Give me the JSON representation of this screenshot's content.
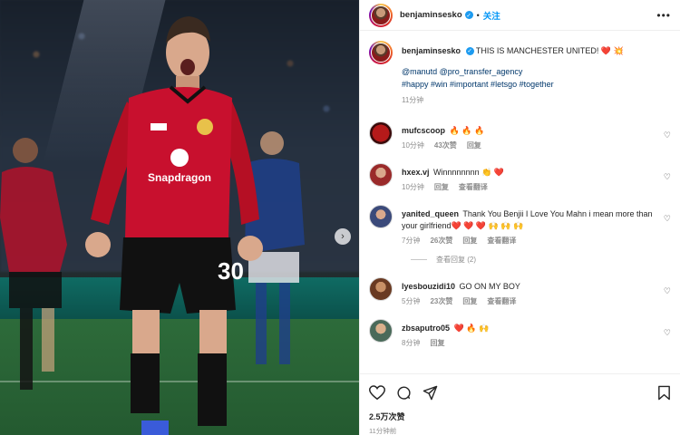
{
  "header": {
    "username": "benjaminsesko",
    "verified_mark": "✓",
    "separator": "•",
    "follow_label": "关注",
    "more_label": "•••"
  },
  "photo": {
    "next_arrow": "›",
    "shirt_sponsor": "Snapdragon",
    "shirt_number": "30"
  },
  "caption": {
    "username": "benjaminsesko",
    "text": "THIS IS MANCHESTER UNITED! ",
    "emoji": "❤️ 💥",
    "mentions": "@manutd @pro_transfer_agency",
    "hashtags": "#happy #win #important #letsgo #together",
    "time": "11分钟"
  },
  "comments": [
    {
      "username": "mufcscoop",
      "text": "🔥 🔥 🔥",
      "time": "10分钟",
      "likes": "43次赞",
      "reply": "回复",
      "translate": "",
      "avatar_color": "#7a1010"
    },
    {
      "username": "hxex.vj",
      "text": "Winnnnnnnn 👏 ❤️",
      "time": "10分钟",
      "likes": "",
      "reply": "回复",
      "translate": "查看翻译",
      "avatar_color": "#9a2a2a"
    },
    {
      "username": "yanited_queen",
      "text": "Thank You Benjii I Love You Mahn i mean more than your girlfriend❤️ ❤️ ❤️ 🙌 🙌 🙌",
      "time": "7分钟",
      "likes": "26次赞",
      "reply": "回复",
      "translate": "查看翻译",
      "avatar_color": "#3b4a7a"
    },
    {
      "username": "lyesbouzidi10",
      "text": "GO ON MY BOY",
      "time": "5分钟",
      "likes": "23次赞",
      "reply": "回复",
      "translate": "查看翻译",
      "avatar_color": "#8a5a3a"
    },
    {
      "username": "zbsaputro05",
      "text": "❤️ 🔥 🙌",
      "time": "8分钟",
      "likes": "",
      "reply": "回复",
      "translate": "",
      "avatar_color": "#4a6a5a"
    }
  ],
  "view_replies_label": "查看回复 (2)",
  "footer": {
    "likes": "2.5万次赞",
    "posted": "11分钟前"
  },
  "icons": {
    "like": "heart-outline",
    "comment": "speech-bubble",
    "share": "paper-plane",
    "save": "bookmark"
  },
  "colors": {
    "accent": "#0095f6",
    "text": "#262626",
    "muted": "#8e8e8e",
    "link": "#00376b",
    "shirt_red": "#c8102e"
  }
}
